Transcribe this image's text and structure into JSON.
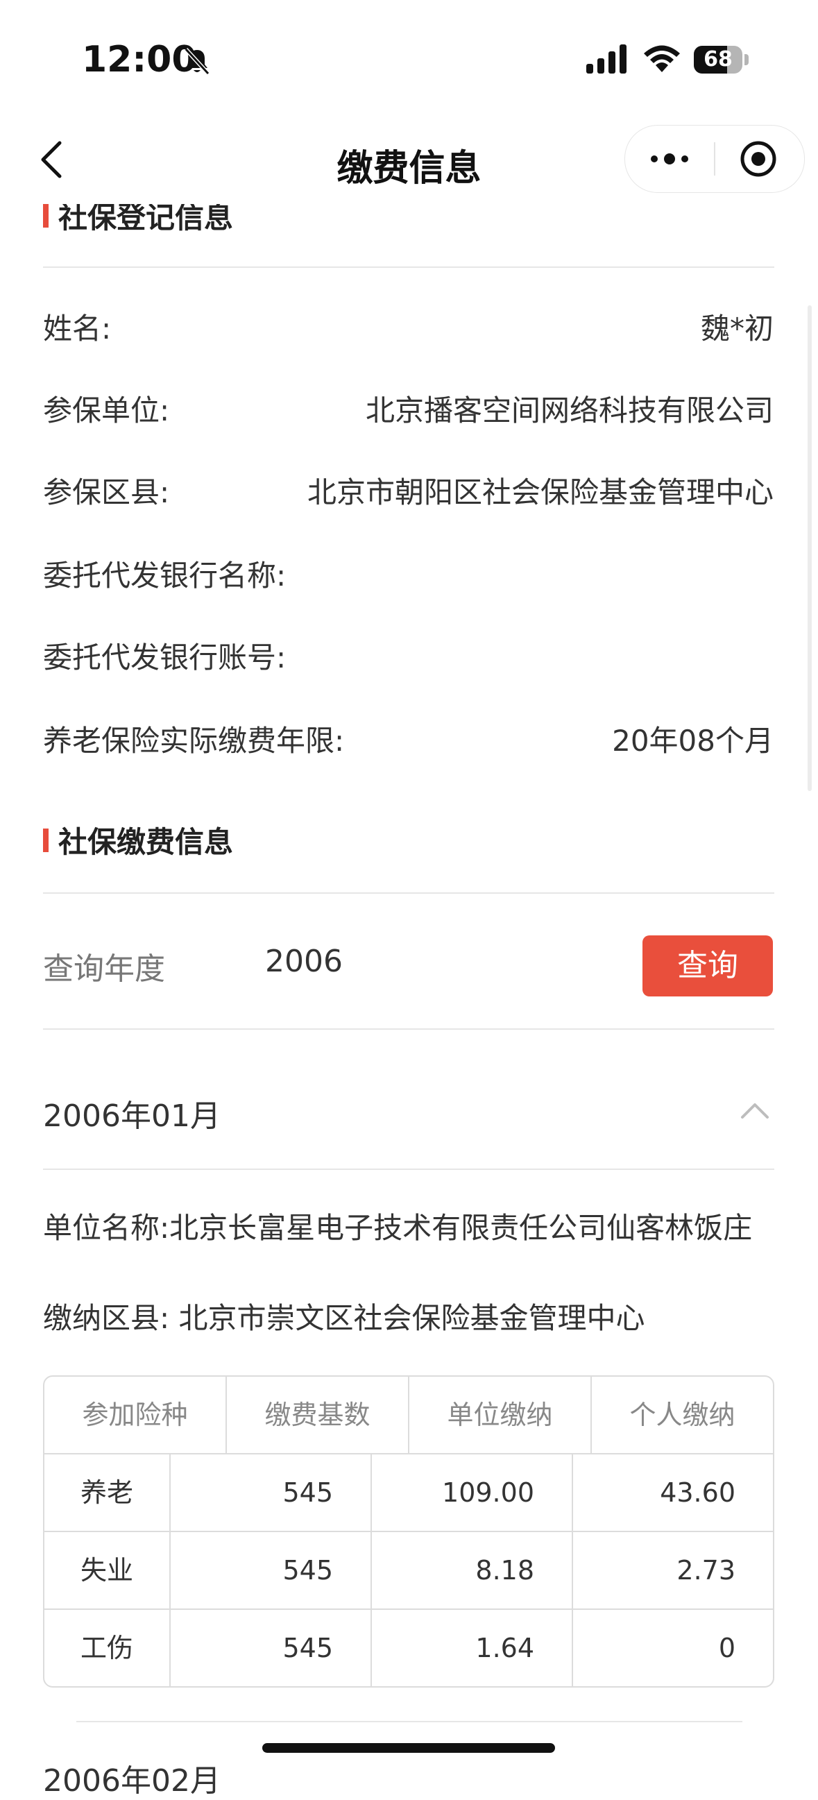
{
  "status_bar": {
    "time": "12:00",
    "battery": "68",
    "battery_level": 0.68
  },
  "nav": {
    "title": "缴费信息"
  },
  "section1": {
    "title": "社保登记信息",
    "rows": [
      {
        "label": "姓名:",
        "value": "魏*初"
      },
      {
        "label": "参保单位:",
        "value": "北京播客空间网络科技有限公司"
      },
      {
        "label": "参保区县:",
        "value": "北京市朝阳区社会保险基金管理中心"
      },
      {
        "label": "委托代发银行名称:",
        "value": ""
      },
      {
        "label": "委托代发银行账号:",
        "value": ""
      },
      {
        "label": "养老保险实际缴费年限:",
        "value": "20年08个月"
      }
    ]
  },
  "section2": {
    "title": "社保缴费信息",
    "query_label": "查询年度",
    "query_year": "2006",
    "query_button": "查询"
  },
  "month_block": {
    "month": "2006年01月",
    "company_label": "单位名称:",
    "company": "北京长富星电子技术有限责任公司仙客林饭庄",
    "district_label": "缴纳区县:",
    "district": "北京市崇文区社会保险基金管理中心",
    "table": {
      "headers": [
        "参加险种",
        "缴费基数",
        "单位缴纳",
        "个人缴纳"
      ],
      "rows": [
        [
          "养老",
          "545",
          "109.00",
          "43.60"
        ],
        [
          "失业",
          "545",
          "8.18",
          "2.73"
        ],
        [
          "工伤",
          "545",
          "1.64",
          "0"
        ]
      ]
    }
  },
  "next_month": "2006年02月",
  "icons": [
    "bell-off-icon",
    "signal-icon",
    "wifi-icon",
    "battery-icon",
    "back-icon",
    "more-icon",
    "target-icon",
    "chevron-up-icon"
  ],
  "colors": {
    "accent": "#e94f3c"
  }
}
